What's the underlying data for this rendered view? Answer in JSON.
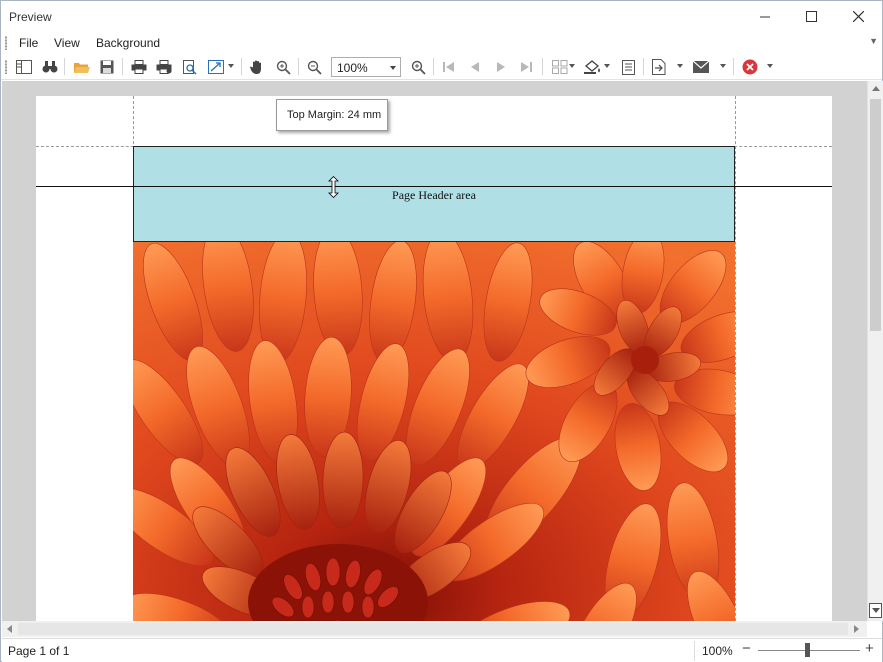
{
  "window": {
    "title": "Preview"
  },
  "menu": {
    "items": [
      "File",
      "View",
      "Background"
    ]
  },
  "toolbar": {
    "buttons": [
      "document-map-icon",
      "find-icon",
      "open-icon",
      "save-icon",
      "print-icon",
      "quick-print-icon",
      "print-preview-icon",
      "scale-icon",
      "hand-tool-icon",
      "magnifier-icon",
      "zoom-out-icon",
      "zoom-in-icon",
      "first-page-icon",
      "previous-page-icon",
      "next-page-icon",
      "last-page-icon",
      "multiple-pages-icon",
      "page-color-icon",
      "watermark-icon",
      "export-icon",
      "send-email-icon",
      "close-preview-icon"
    ],
    "zoom_value": "100%"
  },
  "document": {
    "header_label": "Page Header area",
    "header_color": "#b0e0e6"
  },
  "tooltip": {
    "text": "Top Margin: 24 mm"
  },
  "status": {
    "page_info": "Page 1 of 1",
    "zoom": "100%",
    "zoom_slider_level": 0.5
  },
  "colors": {
    "close_button": "#d9363e",
    "open_folder": "#e8a33d"
  }
}
